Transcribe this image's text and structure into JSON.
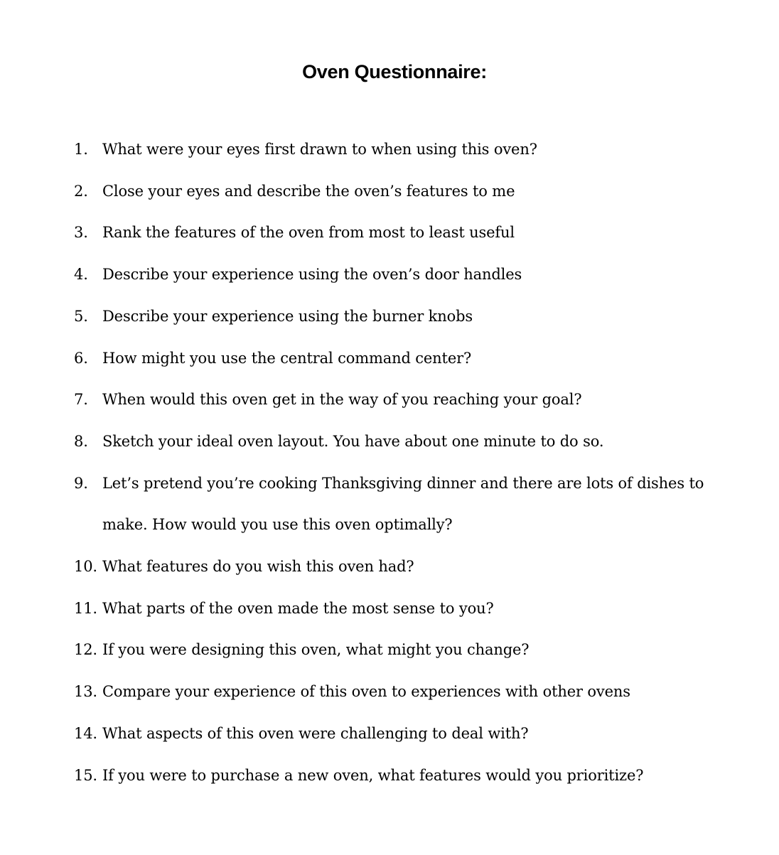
{
  "document": {
    "title": "Oven Questionnaire:",
    "questions": [
      {
        "number": "1.",
        "text": "What were your eyes first drawn to when using this oven?"
      },
      {
        "number": "2.",
        "text": "Close your eyes and describe the oven’s features to me"
      },
      {
        "number": "3.",
        "text": "Rank the features of the oven from most to least useful"
      },
      {
        "number": "4.",
        "text": "Describe your experience using the oven’s door handles"
      },
      {
        "number": "5.",
        "text": "Describe your experience using the burner knobs"
      },
      {
        "number": "6.",
        "text": "How might you use the central command center?"
      },
      {
        "number": "7.",
        "text": "When would this oven get in the way of you reaching your goal?"
      },
      {
        "number": "8.",
        "text": "Sketch your ideal oven layout. You have about one minute to do so."
      },
      {
        "number": "9.",
        "text": "Let’s pretend you’re cooking Thanksgiving dinner and there are lots of dishes to make. How would you use this oven optimally?"
      },
      {
        "number": "10.",
        "text": "What features do you wish this oven had?"
      },
      {
        "number": "11.",
        "text": "What parts of the oven made the most sense to you?"
      },
      {
        "number": "12.",
        "text": "If you were designing this oven, what might you change?"
      },
      {
        "number": "13.",
        "text": "Compare your experience of this oven to experiences with other ovens"
      },
      {
        "number": "14.",
        "text": "What aspects of this oven were challenging to deal with?"
      },
      {
        "number": "15.",
        "text": "If you were to purchase a new oven, what features would you prioritize?"
      }
    ]
  }
}
